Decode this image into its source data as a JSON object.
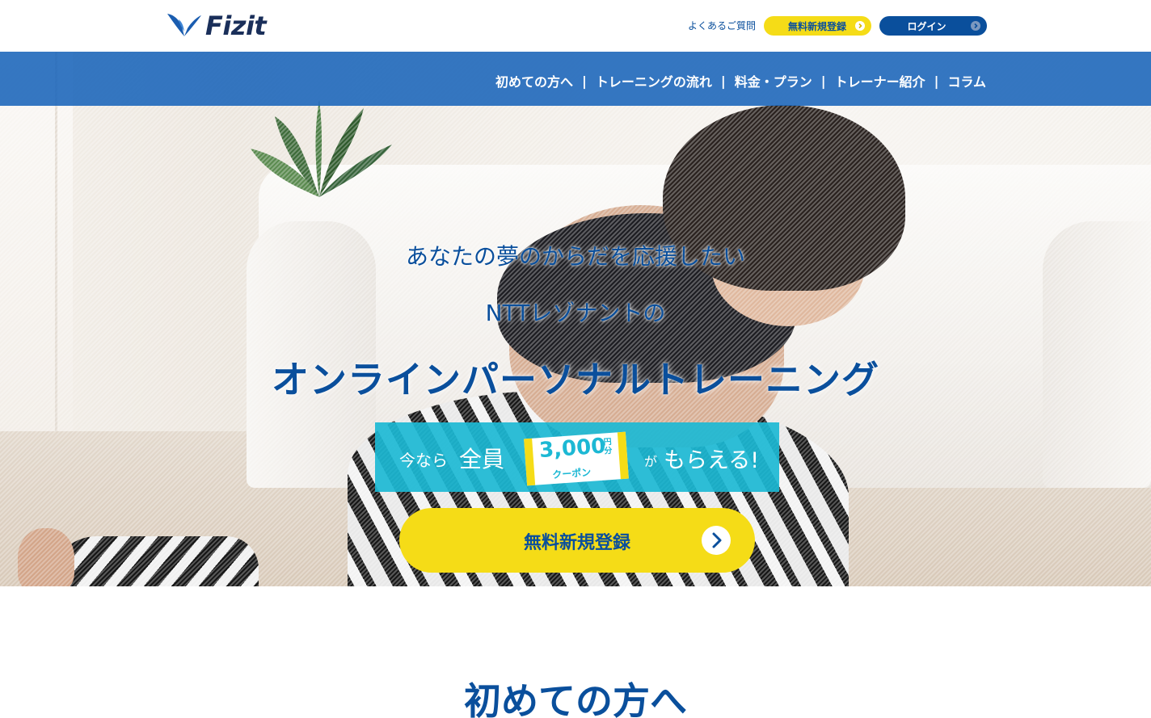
{
  "brand": {
    "name": "Fizit"
  },
  "header": {
    "faq_label": "よくあるご質問",
    "register_label": "無料新規登録",
    "login_label": "ログイン"
  },
  "nav": {
    "items": [
      "初めての方へ",
      "トレーニングの流れ",
      "料金・プラン",
      "トレーナー紹介",
      "コラム"
    ],
    "separator": "|"
  },
  "hero": {
    "subtitle": "あなたの夢のからだを応援したい",
    "company": "NTTレゾナントの",
    "title": "オンラインパーソナルトレーニング",
    "coupon": {
      "prefix": "今なら",
      "highlight": "全員",
      "amount": "3,000",
      "unit": "円分",
      "badge_label": "クーポン",
      "particle": "が",
      "suffix": "もらえる!"
    },
    "cta_label": "無料新規登録"
  },
  "section": {
    "title": "初めての方へ"
  },
  "colors": {
    "primary": "#0a4f9c",
    "nav_bar": "#1964b9",
    "accent_yellow": "#f5dc17",
    "coupon_cyan": "#1cb8d4"
  },
  "icons": {
    "logo": "bird-wings-icon",
    "arrow": "chevron-right-icon"
  }
}
